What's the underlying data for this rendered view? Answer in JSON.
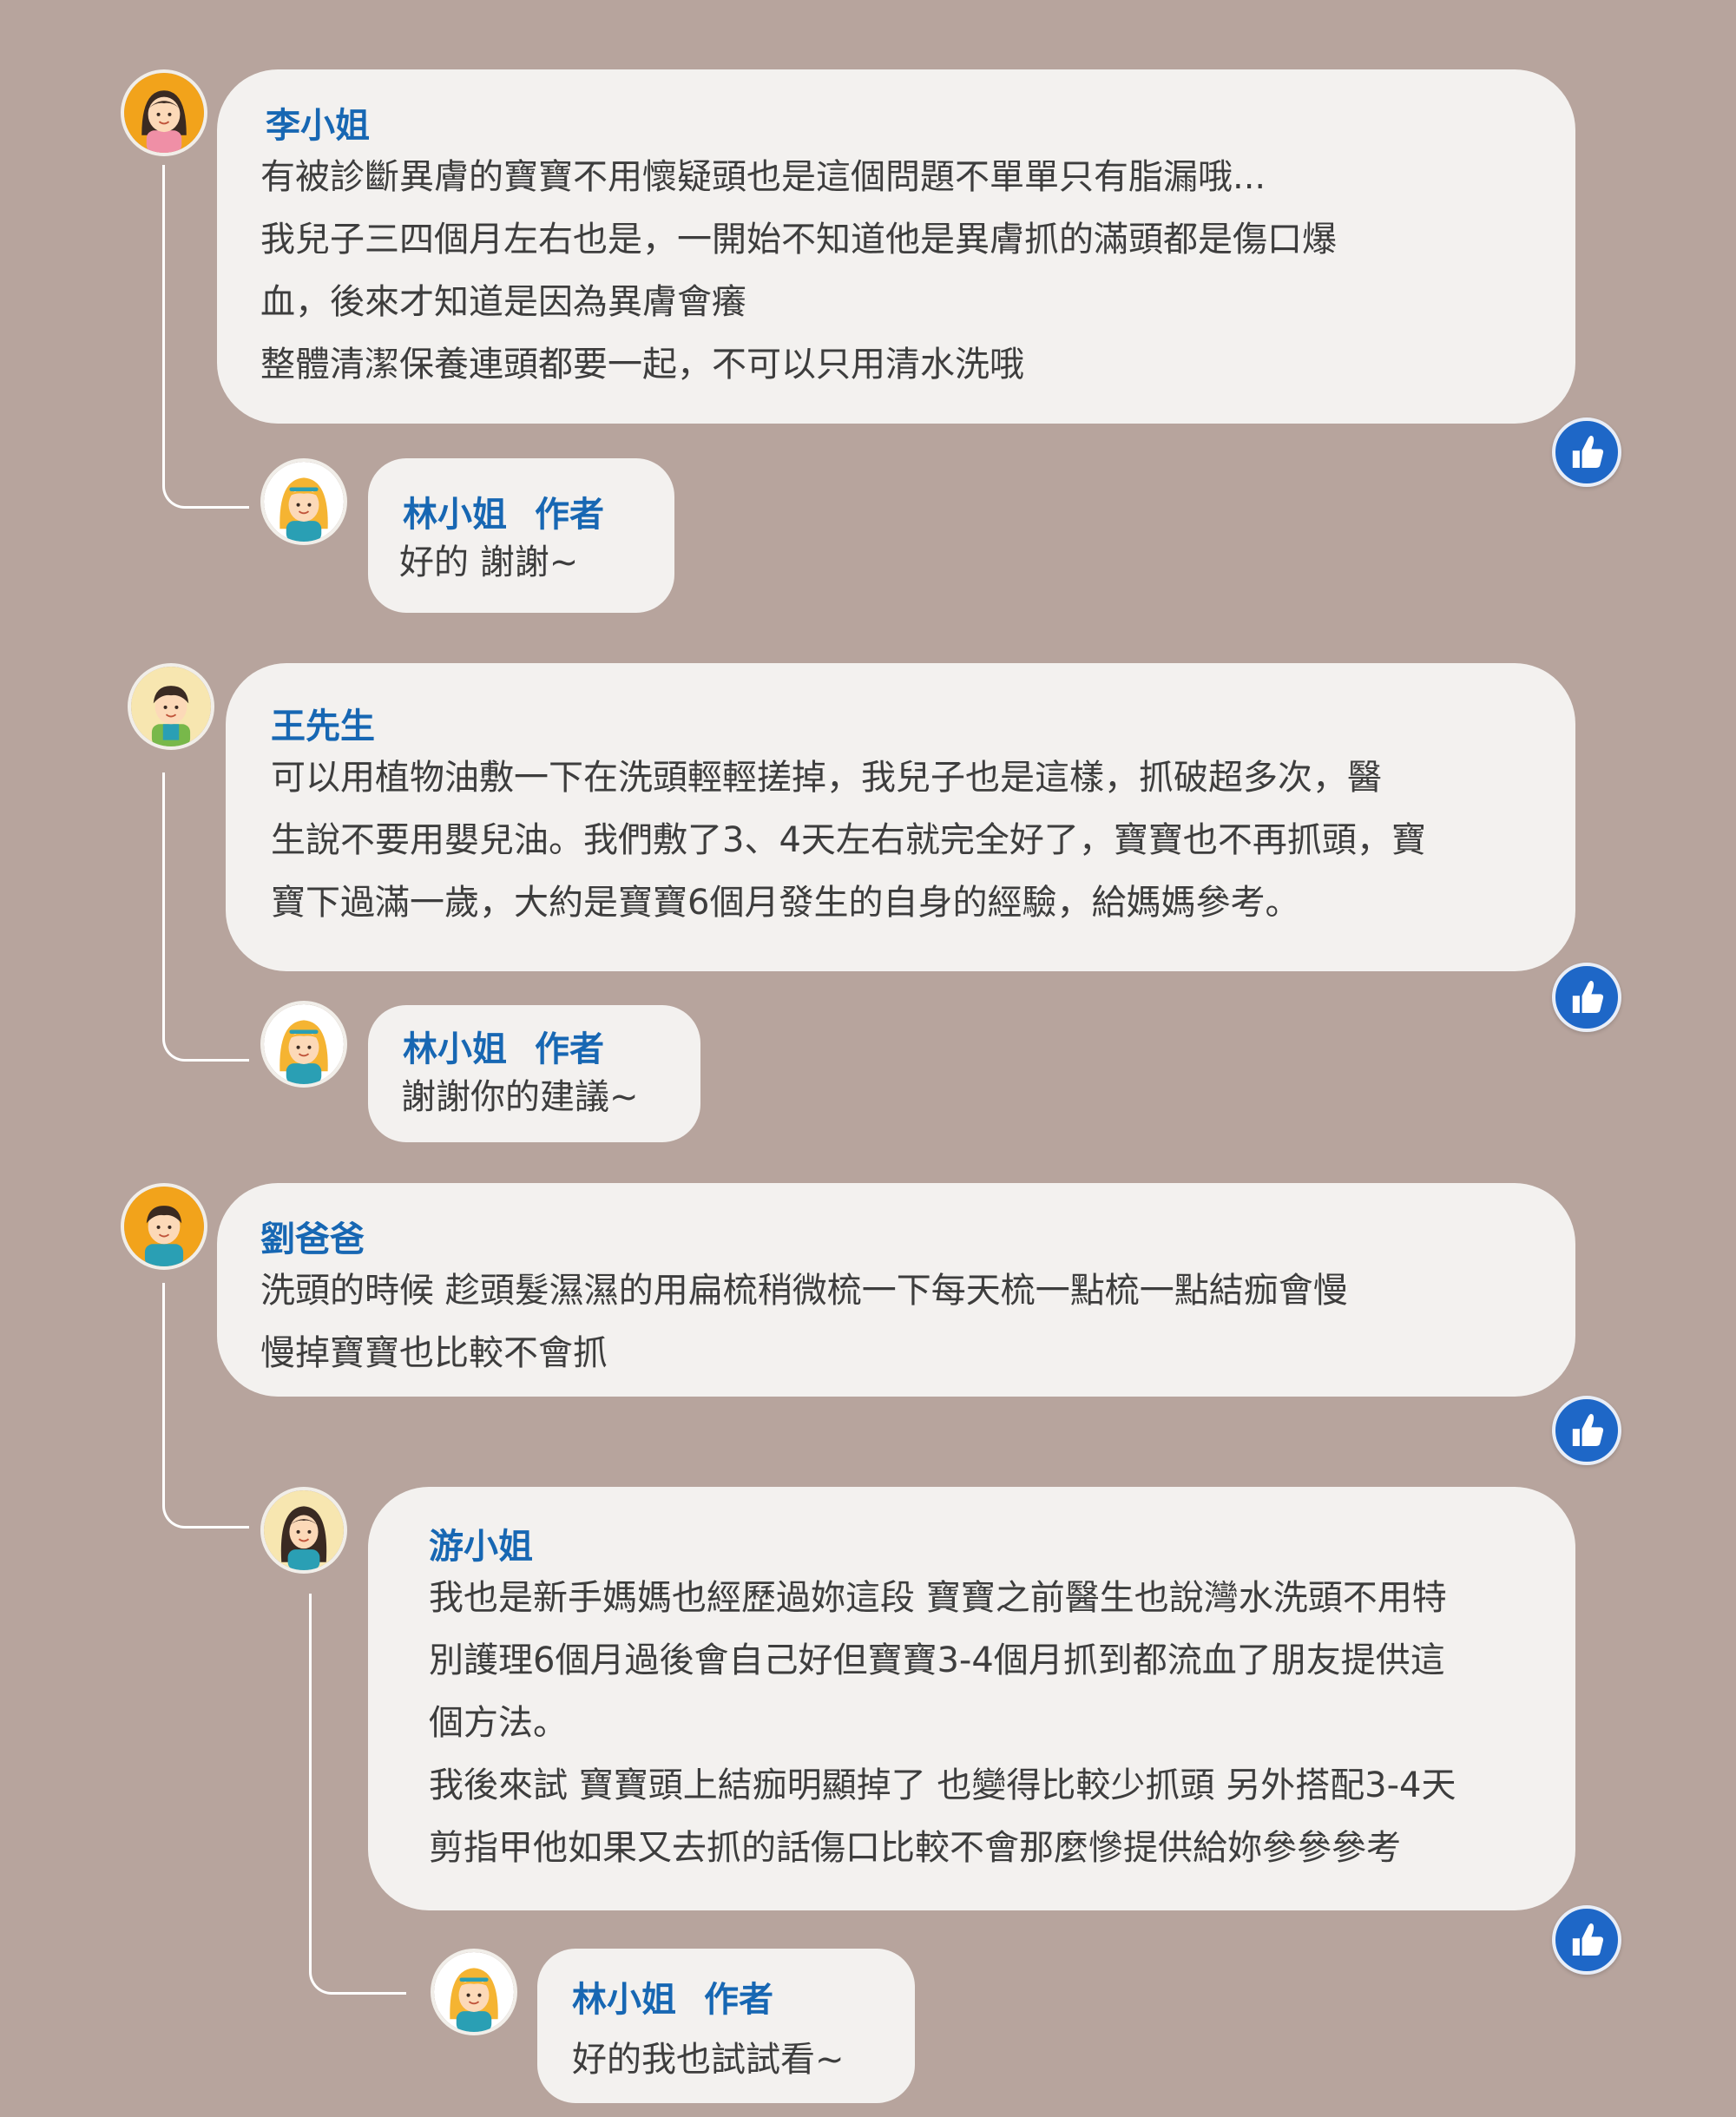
{
  "threads": [
    {
      "comment": {
        "author": "李小姐",
        "lines": [
          "有被診斷異膚的寶寶不用懷疑頭也是這個問題不單單只有脂漏哦...",
          "我兒子三四個月左右也是，一開始不知道他是異膚抓的滿頭都是傷口爆",
          "血，後來才知道是因為異膚會癢",
          "整體清潔保養連頭都要一起，不可以只用清水洗哦"
        ]
      },
      "reply": {
        "author": "林小姐",
        "badge": "作者",
        "text": "好的  謝謝~"
      }
    },
    {
      "comment": {
        "author": "王先生",
        "lines": [
          "可以用植物油敷一下在洗頭輕輕搓掉，我兒子也是這樣，抓破超多次，醫",
          "生說不要用嬰兒油。我們敷了3、4天左右就完全好了，寶寶也不再抓頭，寶",
          "寶下過滿一歲，大約是寶寶6個月發生的自身的經驗，給媽媽參考。"
        ]
      },
      "reply": {
        "author": "林小姐",
        "badge": "作者",
        "text": "謝謝你的建議~"
      }
    },
    {
      "comment": {
        "author": "劉爸爸",
        "lines": [
          "洗頭的時候 趁頭髮濕濕的用扁梳稍微梳一下每天梳一點梳一點結痂會慢",
          "慢掉寶寶也比較不會抓"
        ]
      },
      "sub_comment": {
        "author": "游小姐",
        "lines": [
          "我也是新手媽媽也經歷過妳這段 寶寶之前醫生也說灣水洗頭不用特",
          "別護理6個月過後會自己好但寶寶3-4個月抓到都流血了朋友提供這",
          "個方法。",
          "我後來試 寶寶頭上結痂明顯掉了 也變得比較少抓頭 另外搭配3-4天",
          "剪指甲他如果又去抓的話傷口比較不會那麼慘提供給妳參參參考"
        ]
      },
      "reply": {
        "author": "林小姐",
        "badge": "作者",
        "text": "好的我也試試看~"
      }
    }
  ],
  "icons": {
    "like": "thumbs-up-icon",
    "avatar": "user-avatar"
  },
  "colors": {
    "background": "#b7a49d",
    "bubble": "#f3f1ef",
    "name": "#1767b3",
    "text": "#3d3d3d",
    "like": "#1e67c7",
    "avatar_ring": "#f2a31b"
  }
}
